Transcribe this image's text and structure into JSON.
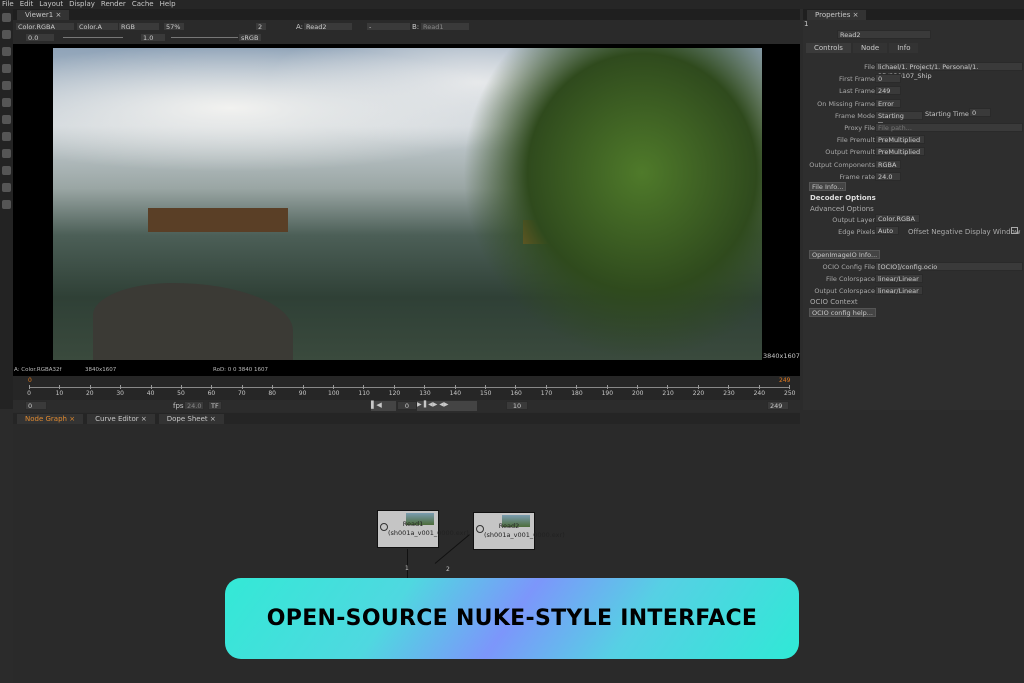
{
  "menu": [
    "File",
    "Edit",
    "Layout",
    "Display",
    "Render",
    "Cache",
    "Help"
  ],
  "viewer": {
    "tab": "Viewer1",
    "layer": "Color.RGBA",
    "alpha": "Color.A",
    "display": "RGB",
    "zoom": "57%",
    "gain": "0.0",
    "gamma": "1.0",
    "count": "2",
    "a_label": "A:",
    "a_input": "Read2",
    "mid": "-",
    "b_label": "B:",
    "b_input": "Read1",
    "lut": "sRGB",
    "resolution": "3840x1607",
    "info_left": "A: Color.RGBA32f",
    "info_res": "3840x1607",
    "info_rod": "RoD: 0 0 3840 1607"
  },
  "timeline": {
    "start_marker": "0",
    "end_marker": "249",
    "ticks": [
      0,
      10,
      20,
      30,
      40,
      50,
      60,
      70,
      80,
      90,
      100,
      110,
      120,
      130,
      140,
      150,
      160,
      170,
      180,
      190,
      200,
      210,
      220,
      230,
      240,
      250
    ],
    "in": "0",
    "fps_label": "fps:",
    "fps": "24.0",
    "tf": "TF",
    "frame": "0",
    "step": "10",
    "out": "249"
  },
  "bottom_tabs": [
    "Node Graph",
    "Curve Editor",
    "Dope Sheet"
  ],
  "nodes": [
    {
      "name": "Read1",
      "file": "(sh001a_v001_0000.exr)",
      "input": "1"
    },
    {
      "name": "Read2",
      "file": "(sh001a_v001_0000.exr)",
      "input": "2"
    }
  ],
  "properties": {
    "tab": "Properties",
    "count": "1",
    "node": "Read2",
    "subtabs": [
      "Controls",
      "Node",
      "Info"
    ],
    "rows": [
      {
        "label": "File",
        "value": "lichael/1. Project/1. Personal/1. 3D/230107_Ship"
      },
      {
        "label": "First Frame",
        "value": "0"
      },
      {
        "label": "Last Frame",
        "value": "249"
      },
      {
        "label": "On Missing Frame",
        "value": "Error"
      },
      {
        "label": "Frame Mode",
        "value": "Starting Time"
      },
      {
        "label": "Proxy File",
        "value": "File path..."
      },
      {
        "label": "File Premult",
        "value": "PreMultiplied"
      },
      {
        "label": "Output Premult",
        "value": "PreMultiplied"
      },
      {
        "label": "Output Components",
        "value": "RGBA"
      },
      {
        "label": "Frame rate",
        "value": "24.0"
      }
    ],
    "starting_time_label": "Starting Time",
    "starting_time": "0",
    "file_info": "File Info...",
    "decoder": "Decoder Options",
    "advanced": "Advanced Options",
    "output_layer_label": "Output Layer",
    "output_layer": "Color.RGBA",
    "edge_label": "Edge Pixels",
    "edge": "Auto",
    "offset": "Offset Negative Display Window",
    "oiio": "OpenImageIO Info...",
    "ocio_rows": [
      {
        "label": "OCIO Config File",
        "value": "[OCIO]/config.ocio"
      },
      {
        "label": "File Colorspace",
        "value": "linear/Linear"
      },
      {
        "label": "Output Colorspace",
        "value": "linear/Linear"
      }
    ],
    "ocio_context": "OCIO Context",
    "ocio_help": "OCIO config help..."
  },
  "banner": "OPEN-SOURCE NUKE-STYLE INTERFACE"
}
